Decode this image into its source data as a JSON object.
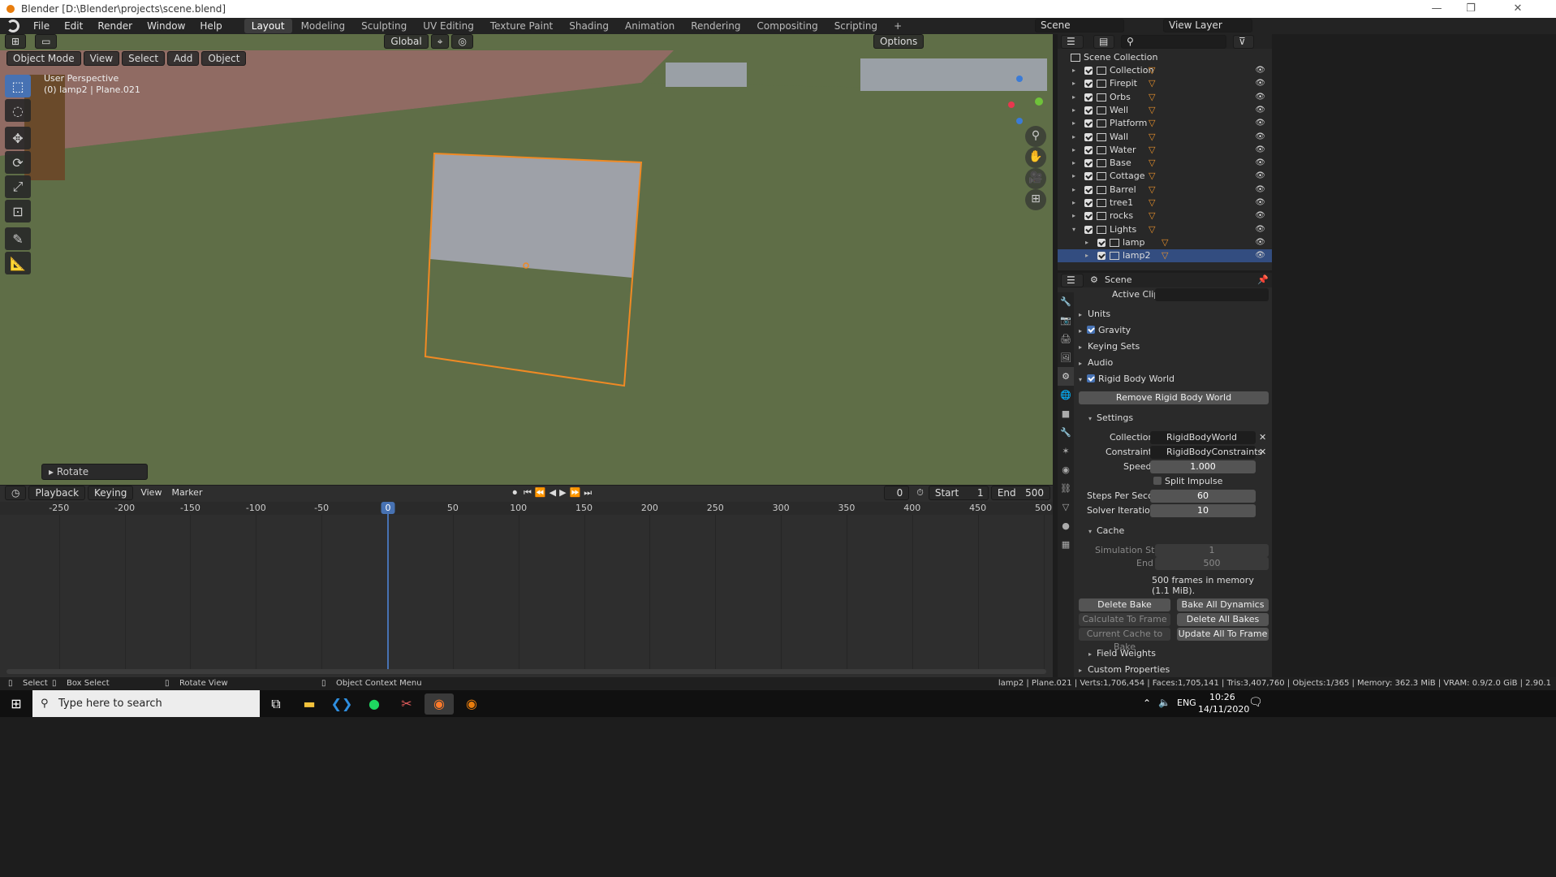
{
  "window": {
    "title": "Blender [D:\\Blender\\projects\\scene.blend]",
    "minimize": "—",
    "maximize": "❐",
    "close": "✕"
  },
  "menu": [
    "File",
    "Edit",
    "Render",
    "Window",
    "Help"
  ],
  "workspaces": [
    "Layout",
    "Modeling",
    "Sculpting",
    "UV Editing",
    "Texture Paint",
    "Shading",
    "Animation",
    "Rendering",
    "Compositing",
    "Scripting",
    "+"
  ],
  "active_workspace": "Layout",
  "scene_selector": "Scene",
  "view_layer": "View Layer",
  "viewport": {
    "transform_orientation": "Global",
    "options": "Options",
    "mode": "Object Mode",
    "header_menus": [
      "View",
      "Select",
      "Add",
      "Object"
    ],
    "perspective_label": "User Perspective",
    "active_object_label": "(0) lamp2 | Plane.021",
    "last_operator": "Rotate",
    "floor_color": "#5f6e47",
    "wall_color": "#906b63",
    "plane_color": "#9ea1a8",
    "selection_color": "#f08a24"
  },
  "outliner": {
    "root": "Scene Collection",
    "items": [
      {
        "name": "Collection",
        "expanded": false,
        "child": false
      },
      {
        "name": "Firepit",
        "expanded": false,
        "child": false
      },
      {
        "name": "Orbs",
        "expanded": false,
        "child": false
      },
      {
        "name": "Well",
        "expanded": false,
        "child": false
      },
      {
        "name": "Platform",
        "expanded": false,
        "child": false
      },
      {
        "name": "Wall",
        "expanded": false,
        "child": false
      },
      {
        "name": "Water",
        "expanded": false,
        "child": false
      },
      {
        "name": "Base",
        "expanded": false,
        "child": false
      },
      {
        "name": "Cottage",
        "expanded": false,
        "child": false
      },
      {
        "name": "Barrel",
        "expanded": false,
        "child": false
      },
      {
        "name": "tree1",
        "expanded": false,
        "child": false
      },
      {
        "name": "rocks",
        "expanded": false,
        "child": false
      },
      {
        "name": "Lights",
        "expanded": true,
        "child": false
      },
      {
        "name": "lamp",
        "expanded": false,
        "child": true
      },
      {
        "name": "lamp2",
        "expanded": false,
        "child": true
      }
    ]
  },
  "properties": {
    "context": "Scene",
    "active_clip_label": "Active Clip",
    "panels": {
      "units": "Units",
      "gravity": "Gravity",
      "keying_sets": "Keying Sets",
      "audio": "Audio",
      "rigid_body_world": "Rigid Body World",
      "remove_rbw": "Remove Rigid Body World",
      "settings": "Settings",
      "cache": "Cache",
      "field_weights": "Field Weights",
      "custom_properties": "Custom Properties"
    },
    "fields": {
      "collection_label": "Collection",
      "collection_value": "RigidBodyWorld",
      "constraints_label": "Constraints",
      "constraints_value": "RigidBodyConstraints",
      "speed_label": "Speed",
      "speed_value": "1.000",
      "split_impulse": "Split Impulse",
      "steps_label": "Steps Per Second",
      "steps_value": "60",
      "solver_label": "Solver Iterations",
      "solver_value": "10",
      "sim_start_label": "Simulation Start",
      "sim_start_value": "1",
      "end_label": "End",
      "end_value": "500",
      "memory_info": "500 frames in memory (1.1 MiB)."
    },
    "buttons": {
      "delete_bake": "Delete Bake",
      "bake_all": "Bake All Dynamics",
      "calc_to_frame": "Calculate To Frame",
      "delete_all_bakes": "Delete All Bakes",
      "current_cache": "Current Cache to Bake",
      "update_all": "Update All To Frame"
    }
  },
  "timeline": {
    "menus": [
      "Playback",
      "Keying",
      "View",
      "Marker"
    ],
    "current_frame": "0",
    "start_label": "Start",
    "start_value": "1",
    "end_label": "End",
    "end_value": "500",
    "ruler": [
      "-250",
      "-200",
      "-150",
      "-100",
      "-50",
      "0",
      "50",
      "100",
      "150",
      "200",
      "250",
      "300",
      "350",
      "400",
      "450",
      "500"
    ]
  },
  "statusbar": {
    "select": "Select",
    "box_select": "Box Select",
    "rotate_view": "Rotate View",
    "context_menu": "Object Context Menu",
    "stats": "lamp2 | Plane.021 | Verts:1,706,454 | Faces:1,705,141 | Tris:3,407,760 | Objects:1/365 | Memory: 362.3 MiB | VRAM: 0.9/2.0 GiB | 2.90.1"
  },
  "taskbar": {
    "search_placeholder": "Type here to search",
    "lang": "ENG",
    "time": "10:26",
    "date": "14/11/2020"
  }
}
